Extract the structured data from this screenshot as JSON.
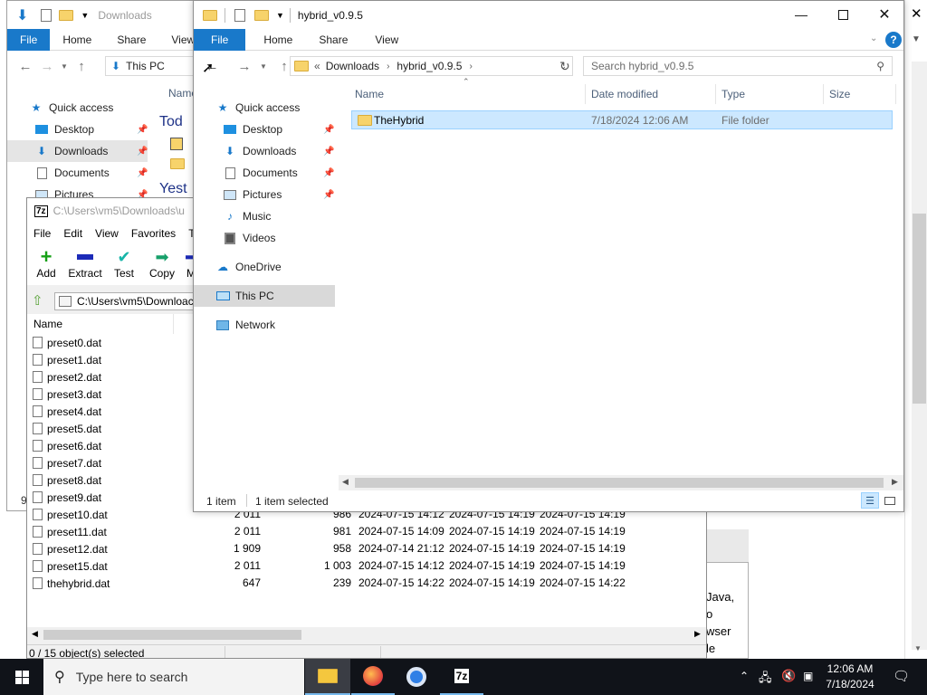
{
  "colors": {
    "accent": "#1979ca",
    "selection": "#cce8ff",
    "selection_border": "#99d1ff",
    "taskbar": "#101319",
    "folder": "#f7d36b"
  },
  "back_explorer": {
    "title": "Downloads",
    "tabs": [
      "File",
      "Home",
      "Share",
      "View"
    ],
    "address": "This PC",
    "column": "Name",
    "group_today": "Tod",
    "group_yesterday": "Yest",
    "nav": [
      "Quick access",
      "Desktop",
      "Downloads",
      "Documents",
      "Pictures"
    ],
    "status": "9"
  },
  "sevenzip": {
    "title": "C:\\Users\\vm5\\Downloads\\u",
    "menu": [
      "File",
      "Edit",
      "View",
      "Favorites",
      "To"
    ],
    "toolbar": [
      {
        "label": "Add",
        "icon": "add-icon"
      },
      {
        "label": "Extract",
        "icon": "extract-icon"
      },
      {
        "label": "Test",
        "icon": "test-icon"
      },
      {
        "label": "Copy",
        "icon": "copy-icon"
      },
      {
        "label": "M",
        "icon": "move-icon"
      }
    ],
    "path": "C:\\Users\\vm5\\Downloac",
    "column_name": "Name",
    "files": [
      {
        "name": "preset0.dat"
      },
      {
        "name": "preset1.dat"
      },
      {
        "name": "preset2.dat"
      },
      {
        "name": "preset3.dat"
      },
      {
        "name": "preset4.dat"
      },
      {
        "name": "preset5.dat"
      },
      {
        "name": "preset6.dat"
      },
      {
        "name": "preset7.dat"
      },
      {
        "name": "preset8.dat"
      },
      {
        "name": "preset9.dat"
      },
      {
        "name": "preset10.dat",
        "size": "2 011",
        "packed": "986",
        "modified": "2024-07-15 14:12",
        "created": "2024-07-15 14:19",
        "accessed": "2024-07-15 14:19"
      },
      {
        "name": "preset11.dat",
        "size": "2 011",
        "packed": "981",
        "modified": "2024-07-15 14:09",
        "created": "2024-07-15 14:19",
        "accessed": "2024-07-15 14:19"
      },
      {
        "name": "preset12.dat",
        "size": "1 909",
        "packed": "958",
        "modified": "2024-07-14 21:12",
        "created": "2024-07-15 14:19",
        "accessed": "2024-07-15 14:19"
      },
      {
        "name": "preset15.dat",
        "size": "2 011",
        "packed": "1 003",
        "modified": "2024-07-15 14:12",
        "created": "2024-07-15 14:19",
        "accessed": "2024-07-15 14:19"
      },
      {
        "name": "thehybrid.dat",
        "size": "647",
        "packed": "239",
        "modified": "2024-07-15 14:22",
        "created": "2024-07-15 14:19",
        "accessed": "2024-07-15 14:22"
      }
    ],
    "status": "0 / 15 object(s) selected"
  },
  "right_panel_text": [
    "Java,",
    "o",
    "wser",
    "le"
  ],
  "explorer": {
    "title": "hybrid_v0.9.5",
    "tabs": [
      "File",
      "Home",
      "Share",
      "View"
    ],
    "breadcrumb_prefix": "«",
    "breadcrumb": [
      "Downloads",
      "hybrid_v0.9.5"
    ],
    "search_placeholder": "Search hybrid_v0.9.5",
    "nav": {
      "quick_access": "Quick access",
      "desktop": "Desktop",
      "downloads": "Downloads",
      "documents": "Documents",
      "pictures": "Pictures",
      "music": "Music",
      "videos": "Videos",
      "onedrive": "OneDrive",
      "this_pc": "This PC",
      "network": "Network"
    },
    "columns": {
      "name": "Name",
      "date": "Date modified",
      "type": "Type",
      "size": "Size"
    },
    "row": {
      "name": "TheHybrid",
      "date": "7/18/2024 12:06 AM",
      "type": "File folder"
    },
    "status_count": "1 item",
    "status_selected": "1 item selected"
  },
  "taskbar": {
    "search_placeholder": "Type here to search",
    "time": "12:06 AM",
    "date": "7/18/2024",
    "apps": [
      "file-explorer-icon",
      "firefox-icon",
      "chrome-icon",
      "7zip-icon"
    ]
  }
}
